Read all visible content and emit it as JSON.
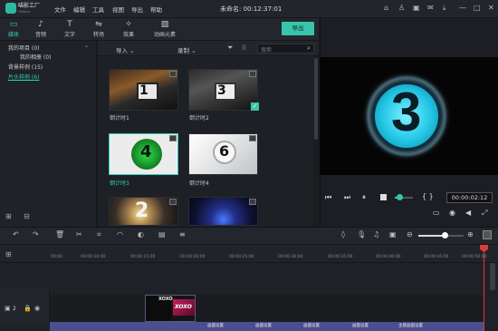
{
  "app": {
    "logo_text": "喵影工厂",
    "logo_sub": "Filmora",
    "project_title": "未命名: 00:12:37:01"
  },
  "menu": [
    "文件",
    "编辑",
    "工具",
    "视图",
    "导出",
    "帮助"
  ],
  "tools": [
    {
      "label": "媒体",
      "icon": "folder-icon",
      "active": true
    },
    {
      "label": "音频",
      "icon": "music-icon",
      "active": false
    },
    {
      "label": "文字",
      "icon": "text-icon",
      "active": false
    },
    {
      "label": "转场",
      "icon": "transition-icon",
      "active": false
    },
    {
      "label": "效果",
      "icon": "effects-icon",
      "active": false
    },
    {
      "label": "动画元素",
      "icon": "elements-icon",
      "active": false
    }
  ],
  "export_label": "导出",
  "left_tree": {
    "my_project": "我的项目 (0)",
    "my_album": "我的相册 (0)",
    "bg_sample": "背景样例 (15)",
    "intro_sample": "片头样例 (6)"
  },
  "media_bar": {
    "import": "导入",
    "record": "录制",
    "search_placeholder": "搜索"
  },
  "media_items": [
    {
      "caption": "倒计时1",
      "selected": false,
      "digit": "1"
    },
    {
      "caption": "倒计时2",
      "selected": false,
      "digit": "3"
    },
    {
      "caption": "倒计时3",
      "selected": true,
      "digit": "4"
    },
    {
      "caption": "倒计时4",
      "selected": false,
      "digit": "6"
    },
    {
      "caption": "",
      "selected": false,
      "digit": "2"
    },
    {
      "caption": "",
      "selected": false,
      "digit": ""
    }
  ],
  "preview": {
    "digit": "3",
    "timecode": "00:00:02:12",
    "brackets": "{  }"
  },
  "timeline": {
    "ruler_ticks": [
      "00:00",
      "00:00:10:00",
      "00:00:15:00",
      "00:00:20:00",
      "00:00:25:00",
      "00:00:30:00",
      "00:00:35:00",
      "00:00:40:00",
      "00:00:45:00",
      "00:00:50:00"
    ],
    "track_label": "2",
    "clip_text": "XOXO",
    "strip_labels": [
      "画面设置",
      "画面设置",
      "画面设置",
      "画面设置",
      "主题画面设置"
    ]
  },
  "colors": {
    "accent": "#39c5ab",
    "playhead": "#e03b3b"
  }
}
